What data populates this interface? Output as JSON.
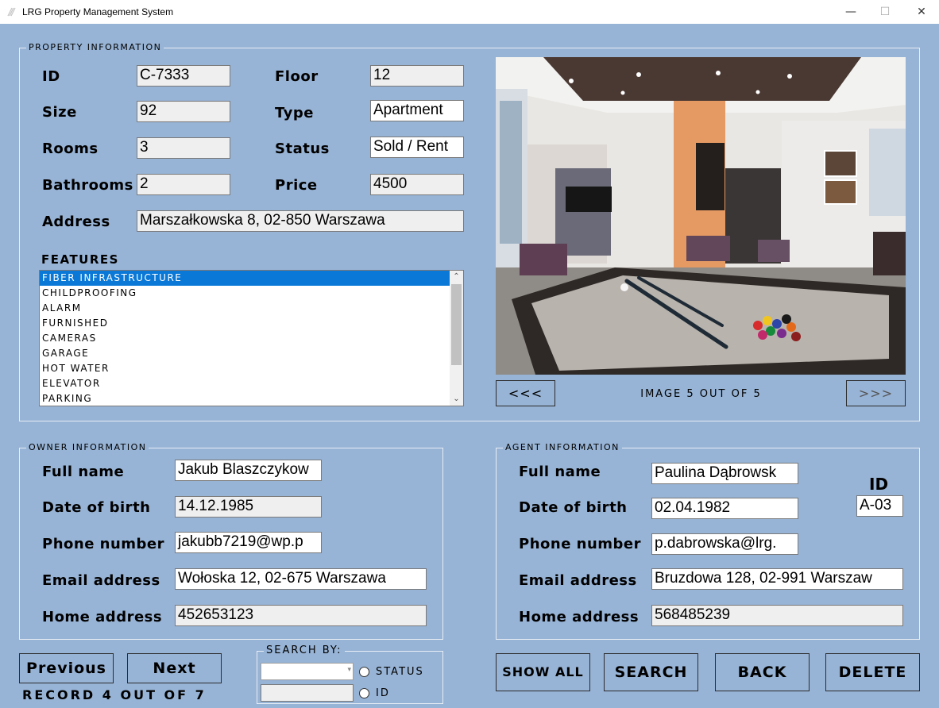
{
  "window": {
    "title": "LRG Property Management System",
    "minimize": "—",
    "maximize": "☐",
    "close": "✕"
  },
  "property": {
    "group_title": "PROPERTY INFORMATION",
    "labels": {
      "id": "ID",
      "size": "Size",
      "rooms": "Rooms",
      "bathrooms": "Bathrooms",
      "address": "Address",
      "floor": "Floor",
      "type": "Type",
      "status": "Status",
      "price": "Price"
    },
    "values": {
      "id": "C-7333",
      "size": "92",
      "rooms": "3",
      "bathrooms": "2",
      "address": "Marszałkowska 8, 02-850 Warszawa",
      "floor": "12",
      "type": "Apartment",
      "status": "Sold / Rent",
      "price": "4500"
    },
    "features_title": "FEATURES",
    "features": [
      "FIBER INFRASTRUCTURE",
      "CHILDPROOFING",
      "ALARM",
      "FURNISHED",
      "CAMERAS",
      "GARAGE",
      "HOT WATER",
      "ELEVATOR",
      "PARKING"
    ],
    "selected_feature": "FIBER INFRASTRUCTURE"
  },
  "gallery": {
    "prev": "<<<",
    "next": ">>>",
    "counter": "IMAGE 5 OUT OF 5"
  },
  "owner": {
    "group_title": "OWNER INFORMATION",
    "labels": {
      "full_name": "Full name",
      "dob": "Date of birth",
      "phone": "Phone number",
      "email": "Email address",
      "home": "Home address"
    },
    "values": {
      "full_name": "Jakub Blaszczykow",
      "dob": "14.12.1985",
      "phone": "jakubb7219@wp.p",
      "email": "Wołoska 12, 02-675 Warszawa",
      "home": "452653123"
    }
  },
  "agent": {
    "group_title": "AGENT INFORMATION",
    "labels": {
      "full_name": "Full name",
      "dob": "Date of birth",
      "phone": "Phone number",
      "email": "Email address",
      "home": "Home address",
      "id": "ID"
    },
    "values": {
      "full_name": "Paulina Dąbrowsk",
      "dob": "02.04.1982",
      "phone": "p.dabrowska@lrg.",
      "email": "Bruzdowa 128, 02-991 Warszaw",
      "home": "568485239",
      "id": "A-03"
    }
  },
  "navigation": {
    "previous": "Previous",
    "next": "Next",
    "record": "RECORD 4 OUT OF 7"
  },
  "search": {
    "group_title": "SEARCH BY:",
    "combo_value": "",
    "text_value": "",
    "option_status": "STATUS",
    "option_id": "ID"
  },
  "actions": {
    "show_all": "SHOW ALL",
    "search": "SEARCH",
    "back": "BACK",
    "delete": "DELETE"
  },
  "colors": {
    "background": "#97b3d5",
    "selection": "#0a78d7",
    "field": "#efefef"
  }
}
